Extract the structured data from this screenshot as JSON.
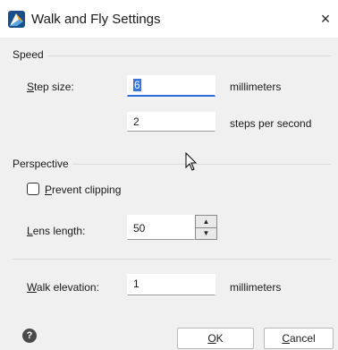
{
  "window": {
    "title": "Walk and Fly Settings",
    "close_glyph": "×",
    "icon": "app-logo-icon"
  },
  "speed": {
    "legend": "Speed",
    "step_size_label_mn": "S",
    "step_size_label_rest": "tep size:",
    "step_size_value": "6",
    "step_size_unit": "millimeters",
    "rate_value": "2",
    "rate_unit": "steps per second"
  },
  "perspective": {
    "legend": "Perspective",
    "prevent_clipping_mn": "P",
    "prevent_clipping_rest": "revent clipping",
    "prevent_clipping_checked": false,
    "lens_length_mn": "L",
    "lens_length_rest": "ens length:",
    "lens_length_value": "50"
  },
  "walk": {
    "label_mn": "W",
    "label_rest": "alk elevation:",
    "value": "1",
    "unit": "millimeters"
  },
  "buttons": {
    "help_glyph": "?",
    "ok_mn": "O",
    "ok_rest": "K",
    "cancel_mn": "C",
    "cancel_rest": "ancel"
  },
  "colors": {
    "accent": "#2b6cd8",
    "dialog_bg": "#f0f0f0"
  }
}
